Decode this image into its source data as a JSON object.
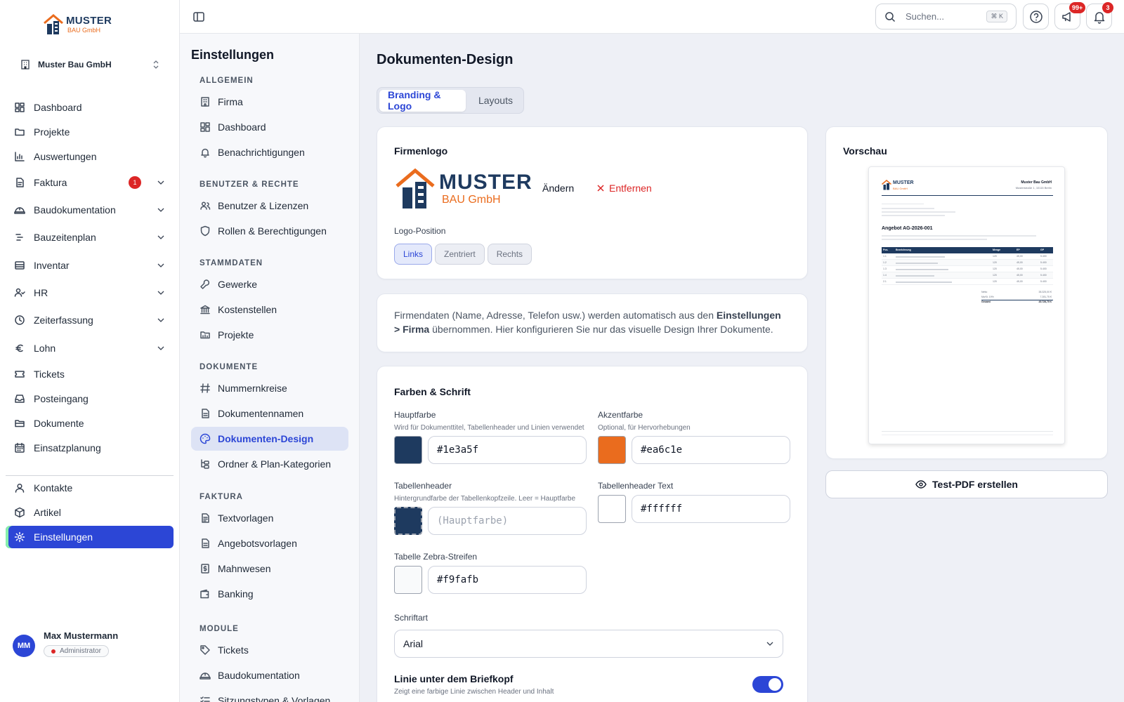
{
  "brand": {
    "name": "MUSTER",
    "sub": "BAU GmbH",
    "primary": "#1e3a5f",
    "accent": "#ea6c1e"
  },
  "company_switch": {
    "name": "Muster Bau GmbH"
  },
  "nav": [
    {
      "label": "Dashboard",
      "icon": "dashboard-icon",
      "badge": "",
      "expand": false
    },
    {
      "label": "Projekte",
      "icon": "folder-icon",
      "badge": "",
      "expand": false
    },
    {
      "label": "Auswertungen",
      "icon": "chart-icon",
      "badge": "",
      "expand": false
    },
    {
      "label": "Faktura",
      "icon": "document-icon",
      "badge": "1",
      "expand": true
    },
    {
      "label": "Baudokumentation",
      "icon": "helmet-icon",
      "badge": "",
      "expand": true
    },
    {
      "label": "Bauzeitenplan",
      "icon": "gantt-icon",
      "badge": "",
      "expand": true
    },
    {
      "label": "Inventar",
      "icon": "inventory-icon",
      "badge": "",
      "expand": true
    },
    {
      "label": "HR",
      "icon": "users-icon",
      "badge": "",
      "expand": true
    },
    {
      "label": "Zeiterfassung",
      "icon": "clock-icon",
      "badge": "",
      "expand": true
    },
    {
      "label": "Lohn",
      "icon": "euro-icon",
      "badge": "",
      "expand": true
    },
    {
      "label": "Tickets",
      "icon": "ticket-icon",
      "badge": "",
      "expand": false
    },
    {
      "label": "Posteingang",
      "icon": "inbox-icon",
      "badge": "",
      "expand": false
    },
    {
      "label": "Dokumente",
      "icon": "folder-open-icon",
      "badge": "",
      "expand": false
    },
    {
      "label": "Einsatzplanung",
      "icon": "calendar-icon",
      "badge": "",
      "expand": false
    },
    {
      "label": "Kontakte",
      "icon": "contacts-icon",
      "badge": "",
      "expand": false
    },
    {
      "label": "Artikel",
      "icon": "box-icon",
      "badge": "",
      "expand": false
    },
    {
      "label": "Einstellungen",
      "icon": "gear-icon",
      "badge": "",
      "expand": false
    }
  ],
  "user": {
    "initials": "MM",
    "name": "Max Mustermann",
    "role": "Administrator"
  },
  "topbar": {
    "search_placeholder": "Suchen...",
    "shortcut": "⌘ K",
    "announce_badge": "99+",
    "notif_badge": "3"
  },
  "settings": {
    "title": "Einstellungen",
    "sections": [
      {
        "head": "ALLGEMEIN",
        "items": [
          "Firma",
          "Dashboard",
          "Benachrichtigungen"
        ]
      },
      {
        "head": "BENUTZER & RECHTE",
        "items": [
          "Benutzer & Lizenzen",
          "Rollen & Berechtigungen"
        ]
      },
      {
        "head": "STAMMDATEN",
        "items": [
          "Gewerke",
          "Kostenstellen",
          "Projekte"
        ]
      },
      {
        "head": "DOKUMENTE",
        "items": [
          "Nummernkreise",
          "Dokumentennamen",
          "Dokumenten-Design",
          "Ordner & Plan-Kategorien"
        ]
      },
      {
        "head": "FAKTURA",
        "items": [
          "Textvorlagen",
          "Angebotsvorlagen",
          "Mahnwesen",
          "Banking"
        ]
      },
      {
        "head": "MODULE",
        "items": [
          "Tickets",
          "Baudokumentation",
          "Sitzungstypen & Vorlagen"
        ]
      }
    ],
    "active": "Dokumenten-Design"
  },
  "page": {
    "title": "Dokumenten-Design",
    "tabs": [
      "Branding & Logo",
      "Layouts"
    ],
    "active_tab": "Branding & Logo"
  },
  "logo_card": {
    "title": "Firmenlogo",
    "change": "Ändern",
    "remove": "Entfernen",
    "position_label": "Logo-Position",
    "positions": [
      "Links",
      "Zentriert",
      "Rechts"
    ],
    "active_position": "Links"
  },
  "info": {
    "text_before": "Firmendaten (Name, Adresse, Telefon usw.) werden automatisch aus den ",
    "link": "Einstellungen > Firma",
    "text_after": " übernommen. Hier konfigurieren Sie nur das visuelle Design Ihrer Dokumente."
  },
  "colors": {
    "title": "Farben & Schrift",
    "primary": {
      "label": "Hauptfarbe",
      "hint": "Wird für Dokumenttitel, Tabellenheader und Linien verwendet",
      "value": "#1e3a5f"
    },
    "accent": {
      "label": "Akzentfarbe",
      "hint": "Optional, für Hervorhebungen",
      "value": "#ea6c1e"
    },
    "table_header": {
      "label": "Tabellenheader",
      "hint": "Hintergrundfarbe der Tabellenkopfzeile. Leer = Hauptfarbe",
      "value": "",
      "placeholder": "(Hauptfarbe)"
    },
    "table_header_text": {
      "label": "Tabellenheader Text",
      "value": "#ffffff"
    },
    "zebra": {
      "label": "Tabelle Zebra-Streifen",
      "value": "#f9fafb"
    },
    "font_label": "Schriftart",
    "font_value": "Arial",
    "line_label": "Linie unter dem Briefkopf",
    "line_hint": "Zeigt eine farbige Linie zwischen Header und Inhalt",
    "line_enabled": true
  },
  "preview": {
    "title": "Vorschau",
    "company": "Muster Bau GmbH",
    "address": "Musterstraße 1, 10115 Berlin",
    "doc_title": "Angebot AG-2026-001",
    "table_head": [
      "Pos.",
      "Bezeichnung",
      "Menge",
      "EP",
      "GP"
    ],
    "rows": [
      [
        "1.1",
        "120",
        "45,00",
        "5.400"
      ],
      [
        "1.2",
        "120",
        "45,00",
        "5.400"
      ],
      [
        "1.3",
        "120",
        "45,00",
        "5.400"
      ],
      [
        "1.4",
        "120",
        "45,00",
        "5.400"
      ],
      [
        "2.1",
        "120",
        "45,00",
        "5.400"
      ]
    ],
    "totals": [
      [
        "Netto",
        "38.325,00 €"
      ],
      [
        "MwSt. 19%",
        "7.281,75 €"
      ],
      [
        "Gesamt",
        "45.726,75 €"
      ]
    ],
    "button": "Test-PDF erstellen"
  }
}
